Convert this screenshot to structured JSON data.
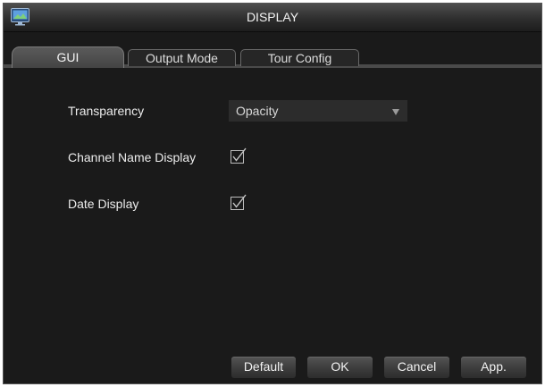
{
  "window": {
    "title": "DISPLAY",
    "icon": "monitor-icon"
  },
  "tabs": [
    {
      "label": "GUI",
      "active": true
    },
    {
      "label": "Output Mode",
      "active": false
    },
    {
      "label": "Tour Config",
      "active": false
    }
  ],
  "form": {
    "transparency": {
      "label": "Transparency",
      "value": "Opacity",
      "arrow_icon": "dropdown-arrow-icon"
    },
    "channel_name_display": {
      "label": "Channel Name Display",
      "checked": true,
      "icon": "checkmark-icon"
    },
    "date_display": {
      "label": "Date Display",
      "checked": true,
      "icon": "checkmark-icon"
    }
  },
  "buttons": {
    "default_label": "Default",
    "ok_label": "OK",
    "cancel_label": "Cancel",
    "apply_label": "App."
  },
  "colors": {
    "background": "#1a1a1a",
    "text": "#ececec",
    "checkmark": "#c8c8c8"
  }
}
